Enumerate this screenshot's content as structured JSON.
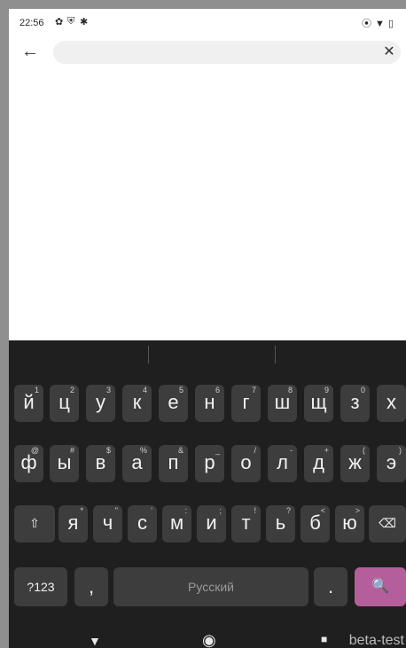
{
  "status": {
    "time": "22:56",
    "icons_left": [
      "settings-icon",
      "shield-icon",
      "bug-icon"
    ],
    "icons_right": [
      "location-icon",
      "wifi-icon",
      "battery-icon"
    ]
  },
  "search": {
    "value": "",
    "placeholder": ""
  },
  "keyboard": {
    "row1": [
      {
        "char": "й",
        "hint": "1"
      },
      {
        "char": "ц",
        "hint": "2"
      },
      {
        "char": "у",
        "hint": "3"
      },
      {
        "char": "к",
        "hint": "4"
      },
      {
        "char": "е",
        "hint": "5"
      },
      {
        "char": "н",
        "hint": "6"
      },
      {
        "char": "г",
        "hint": "7"
      },
      {
        "char": "ш",
        "hint": "8"
      },
      {
        "char": "щ",
        "hint": "9"
      },
      {
        "char": "з",
        "hint": "0"
      },
      {
        "char": "х",
        "hint": ""
      }
    ],
    "row2": [
      {
        "char": "ф",
        "hint": "@"
      },
      {
        "char": "ы",
        "hint": "#"
      },
      {
        "char": "в",
        "hint": "$"
      },
      {
        "char": "а",
        "hint": "%"
      },
      {
        "char": "п",
        "hint": "&"
      },
      {
        "char": "р",
        "hint": "_"
      },
      {
        "char": "о",
        "hint": "/"
      },
      {
        "char": "л",
        "hint": "-"
      },
      {
        "char": "д",
        "hint": "+"
      },
      {
        "char": "ж",
        "hint": "("
      },
      {
        "char": "э",
        "hint": ")"
      }
    ],
    "row3": [
      {
        "char": "я",
        "hint": "*"
      },
      {
        "char": "ч",
        "hint": "\""
      },
      {
        "char": "с",
        "hint": "'"
      },
      {
        "char": "м",
        "hint": ":"
      },
      {
        "char": "и",
        "hint": ";"
      },
      {
        "char": "т",
        "hint": "!"
      },
      {
        "char": "ь",
        "hint": "?"
      },
      {
        "char": "б",
        "hint": "<"
      },
      {
        "char": "ю",
        "hint": ">"
      }
    ],
    "shift_label": "⇧",
    "backspace_label": "⌫",
    "numbers_label": "?123",
    "comma_label": ",",
    "space_label": "Русский",
    "period_label": ".",
    "search_label": "🔍"
  },
  "nav": {
    "back_icon": "▼",
    "home_icon": "◉",
    "recents_icon": "■"
  },
  "watermark": "beta-test",
  "colors": {
    "keyboard_bg": "#1f1f1f",
    "key_bg": "#3d3d3d",
    "search_key": "#b45f9c"
  }
}
